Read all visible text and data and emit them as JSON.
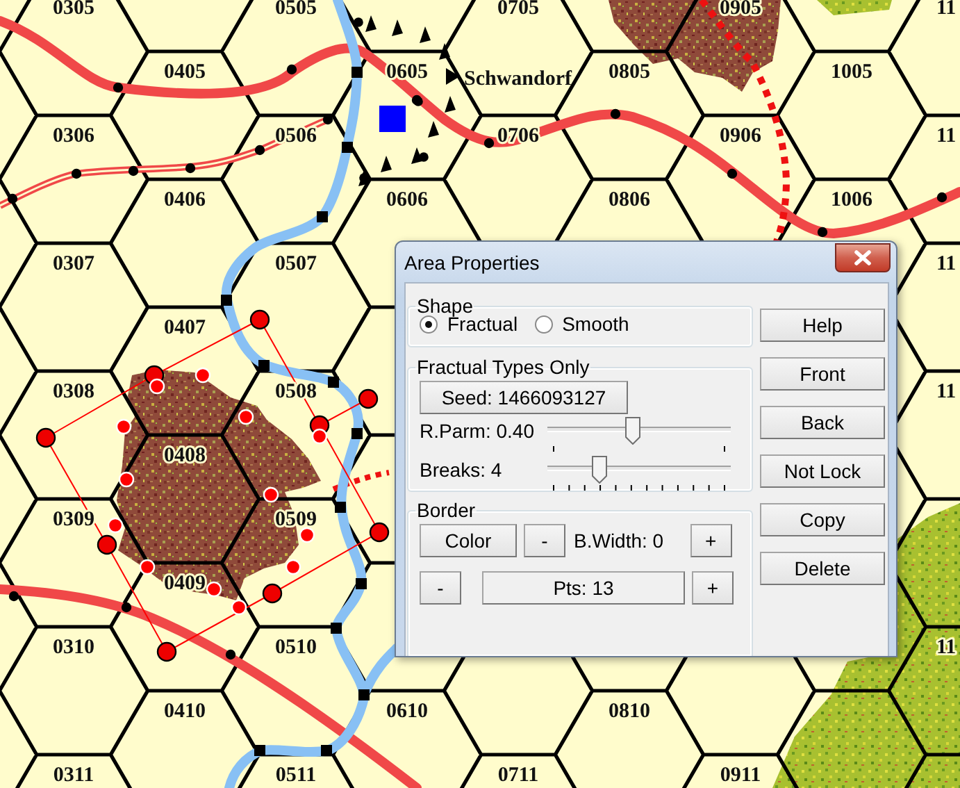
{
  "map": {
    "hex_columns": [
      [
        "0305",
        "0306",
        "0307",
        "0308",
        "0309",
        "0310",
        "0311"
      ],
      [
        "0405",
        "0406",
        "0407",
        "0408",
        "0409",
        "0410"
      ],
      [
        "0505",
        "0506",
        "0507",
        "0508",
        "0509",
        "0510",
        "0511"
      ],
      [
        "0605",
        "0606",
        null,
        null,
        null,
        "0610"
      ],
      [
        "0705",
        "0706",
        null,
        null,
        null,
        null,
        "0711"
      ],
      [
        "0805",
        "0806",
        null,
        null,
        null,
        "0810"
      ],
      [
        "0905",
        "0906",
        null,
        null,
        null,
        null,
        "0911"
      ],
      [
        "1005",
        "1006"
      ],
      [
        "11",
        "11",
        "11",
        "11",
        null,
        "11"
      ]
    ],
    "town": {
      "name": "Schwandorf"
    }
  },
  "dialog": {
    "title": "Area Properties",
    "shape": {
      "legend": "Shape",
      "options": [
        {
          "label": "Fractual",
          "selected": true
        },
        {
          "label": "Smooth",
          "selected": false
        }
      ]
    },
    "fractual": {
      "legend": "Fractual Types Only",
      "seed_button": "Seed: 1466093127",
      "sliders": [
        {
          "label": "R.Parm: 0.40",
          "level": 0.46,
          "kind": "coarse"
        },
        {
          "label": "Breaks: 4",
          "level": 0.28,
          "kind": "fine"
        }
      ]
    },
    "border": {
      "legend": "Border",
      "color_button": "Color",
      "width_minus": "-",
      "width_label": "B.Width: 0",
      "width_plus": "+",
      "points_minus": "-",
      "points_label": "Pts: 13",
      "points_plus": "+"
    },
    "side_buttons": [
      "Help",
      "Front",
      "Back",
      "Not Lock",
      "Copy",
      "Delete"
    ]
  }
}
